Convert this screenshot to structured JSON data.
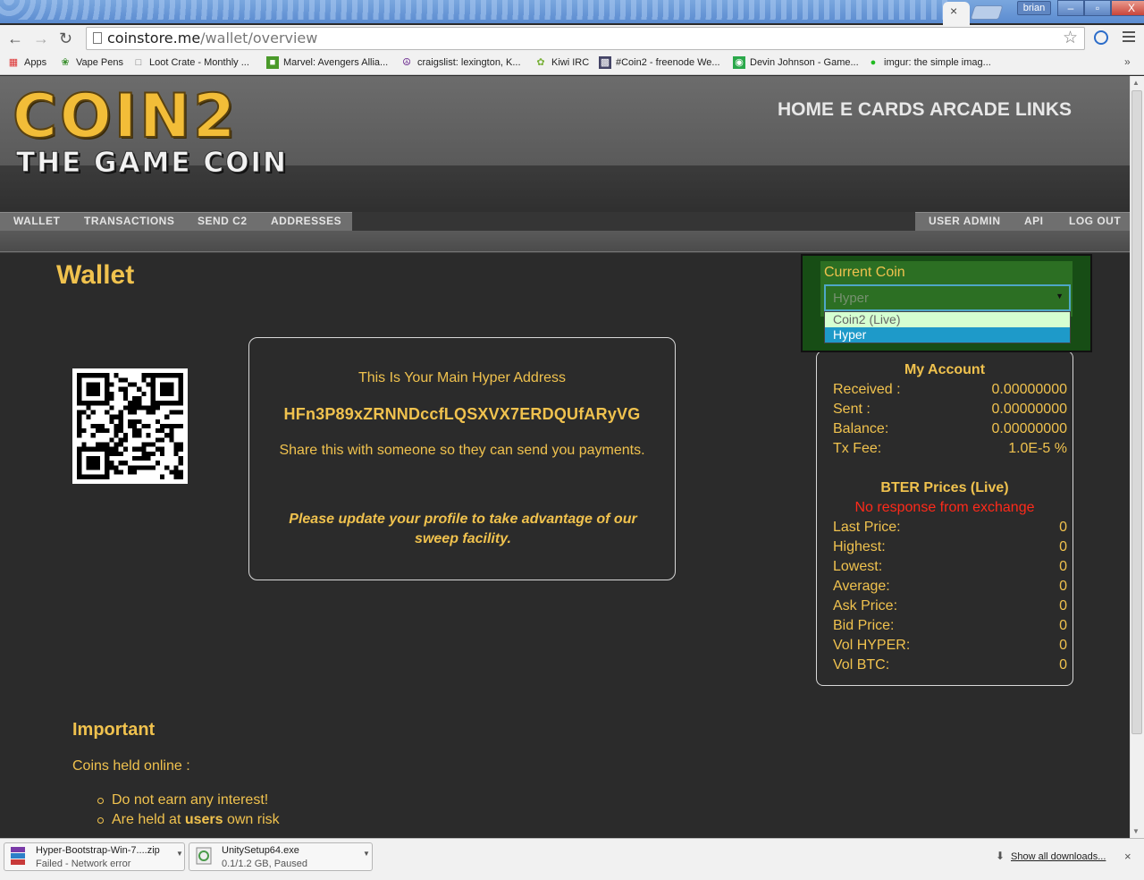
{
  "browser": {
    "tab_close": "×",
    "user_name": "brian",
    "window_buttons": [
      "–",
      "▫",
      "X"
    ],
    "url_host": "coinstore.me",
    "url_path": "/wallet/overview",
    "bookmarks": [
      {
        "label": "Apps",
        "icon": "apps-grid-icon"
      },
      {
        "label": "Vape Pens",
        "icon": "leaf-icon"
      },
      {
        "label": "Loot Crate - Monthly ...",
        "icon": "page-icon"
      },
      {
        "label": "Marvel: Avengers Allia...",
        "icon": "marvel-icon"
      },
      {
        "label": "craigslist: lexington, K...",
        "icon": "peace-icon"
      },
      {
        "label": "Kiwi IRC",
        "icon": "kiwi-icon"
      },
      {
        "label": "#Coin2 - freenode We...",
        "icon": "irc-icon"
      },
      {
        "label": "Devin Johnson - Game...",
        "icon": "gamesite-icon"
      },
      {
        "label": "imgur: the simple imag...",
        "icon": "imgur-icon"
      }
    ],
    "bookmarks_more": "»"
  },
  "header": {
    "logo_main": "COIN2",
    "logo_sub": "THE GAME COIN",
    "top_nav": [
      "HOME",
      "E CARDS",
      "ARCADE",
      "LINKS"
    ],
    "sub_nav_left": [
      "WALLET",
      "TRANSACTIONS",
      "SEND C2",
      "ADDRESSES"
    ],
    "sub_nav_right": [
      "USER ADMIN",
      "API",
      "LOG OUT"
    ]
  },
  "main": {
    "title": "Wallet",
    "address_box": {
      "title": "This Is Your Main Hyper Address",
      "address": "HFn3P89xZRNNDccfLQSXVX7ERDQUfARyVG",
      "share_text": "Share this with someone so they can send you payments.",
      "notice": "Please update your profile to take advantage of our sweep facility."
    },
    "current_coin": {
      "label": "Current Coin",
      "selected": "Hyper",
      "options": [
        "Coin2 (Live)",
        "Hyper"
      ]
    },
    "my_account": {
      "heading": "My Account",
      "rows": [
        {
          "label": "Received :",
          "value": "0.00000000"
        },
        {
          "label": "Sent :",
          "value": "0.00000000"
        },
        {
          "label": "Balance:",
          "value": "0.00000000"
        },
        {
          "label": "Tx Fee:",
          "value": "1.0E-5 %"
        }
      ]
    },
    "prices": {
      "heading": "BTER Prices (Live)",
      "error": "No response from exchange",
      "rows": [
        {
          "label": "Last Price:",
          "value": "0"
        },
        {
          "label": "Highest:",
          "value": "0"
        },
        {
          "label": "Lowest:",
          "value": "0"
        },
        {
          "label": "Average:",
          "value": "0"
        },
        {
          "label": "Ask Price:",
          "value": "0"
        },
        {
          "label": "Bid Price:",
          "value": "0"
        },
        {
          "label": "Vol HYPER:",
          "value": "0"
        },
        {
          "label": "Vol BTC:",
          "value": "0"
        }
      ]
    },
    "important": {
      "title": "Important",
      "subtitle": "Coins held online :",
      "item1": "Do not earn any interest!",
      "item2_pre": "Are held at ",
      "item2_bold": "users",
      "item2_post": " own risk"
    }
  },
  "downloads": {
    "items": [
      {
        "name": "Hyper-Bootstrap-Win-7....zip",
        "status": "Failed - Network error"
      },
      {
        "name": "UnitySetup64.exe",
        "status": "0.1/1.2 GB, Paused"
      }
    ],
    "show_all": "Show all downloads...",
    "close": "×"
  }
}
